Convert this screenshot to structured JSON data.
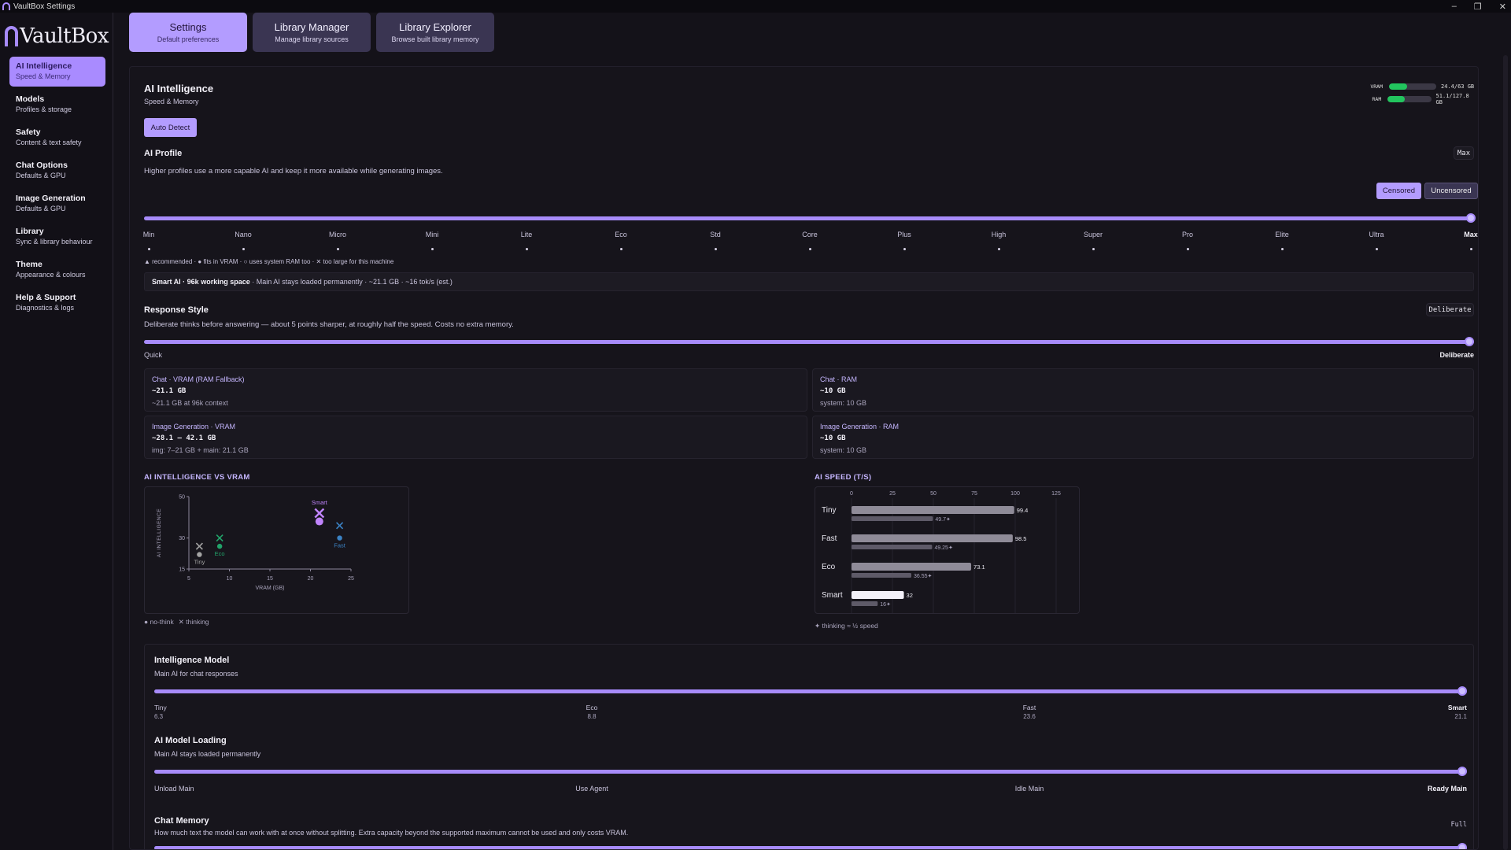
{
  "window": {
    "title": "VaultBox Settings",
    "controls": [
      "–",
      "❐",
      "✕"
    ]
  },
  "brand": {
    "name": "VaultBox"
  },
  "sidebar": {
    "items": [
      {
        "label": "AI Intelligence",
        "sub": "Speed & Memory",
        "active": true
      },
      {
        "label": "Models",
        "sub": "Profiles & storage"
      },
      {
        "label": "Safety",
        "sub": "Content & text safety"
      },
      {
        "label": "Chat Options",
        "sub": "Defaults & GPU"
      },
      {
        "label": "Image Generation",
        "sub": "Defaults & GPU"
      },
      {
        "label": "Library",
        "sub": "Sync & library behaviour"
      },
      {
        "label": "Theme",
        "sub": "Appearance & colours"
      },
      {
        "label": "Help & Support",
        "sub": "Diagnostics & logs"
      }
    ]
  },
  "tabs": [
    {
      "label": "Settings",
      "sub": "Default preferences",
      "active": true
    },
    {
      "label": "Library Manager",
      "sub": "Manage library sources"
    },
    {
      "label": "Library Explorer",
      "sub": "Browse built library memory"
    }
  ],
  "header": {
    "title": "AI Intelligence",
    "subtitle": "Speed & Memory",
    "auto_detect": "Auto Detect"
  },
  "meters": {
    "vram": {
      "label": "VRAM",
      "text": "24.4/63 GB",
      "fraction": 0.39
    },
    "ram": {
      "label": "RAM",
      "text": "51.1/127.8 GB",
      "fraction": 0.4
    },
    "bar_color": "#22c55e"
  },
  "profile": {
    "title": "AI Profile",
    "value": "Max",
    "desc": "Higher profiles use a more capable AI and keep it more available while generating images.",
    "censor": {
      "options": [
        "Censored",
        "Uncensored"
      ],
      "selected": "Censored"
    },
    "ticks": [
      "Min",
      "Nano",
      "Micro",
      "Mini",
      "Lite",
      "Eco",
      "Std",
      "Core",
      "Plus",
      "High",
      "Super",
      "Pro",
      "Elite",
      "Ultra",
      "Max"
    ],
    "selected_index": 14,
    "legend": "▲ recommended · ● fits in VRAM · ○ uses system RAM too · ✕ too large for this machine",
    "summary_bold": "Smart AI · 96k working space",
    "summary_rest": " · Main AI stays loaded permanently · ~21.1 GB · ~16 tok/s (est.)"
  },
  "response": {
    "title": "Response Style",
    "value": "Deliberate",
    "desc": "Deliberate thinks before answering — about 5 points sharper, at roughly half the speed. Costs no extra memory.",
    "min_label": "Quick",
    "max_label": "Deliberate",
    "level": 1.0
  },
  "cards": [
    {
      "title": "Chat · VRAM (RAM Fallback)",
      "value": "~21.1 GB",
      "sub": "~21.1 GB at 96k context"
    },
    {
      "title": "Chat · RAM",
      "value": "~10 GB",
      "sub": "system: 10 GB"
    },
    {
      "title": "Image Generation · VRAM",
      "value": "~28.1 – 42.1 GB",
      "sub": "img: 7–21 GB + main: 21.1 GB"
    },
    {
      "title": "Image Generation · RAM",
      "value": "~10 GB",
      "sub": "system: 10 GB"
    }
  ],
  "chart_data": [
    {
      "type": "scatter",
      "title": "AI INTELLIGENCE VS VRAM",
      "xlabel": "VRAM (GB)",
      "ylabel": "AI INTELLIGENCE",
      "xlim": [
        5,
        25
      ],
      "ylim": [
        15,
        50
      ],
      "xticks": [
        5,
        10,
        15,
        20,
        25
      ],
      "yticks": [
        15,
        30,
        50
      ],
      "points": [
        {
          "label": "Tiny",
          "x": 6.3,
          "no_think": 22,
          "thinking": 26,
          "color": "#a3a3a3"
        },
        {
          "label": "Eco",
          "x": 8.8,
          "no_think": 26,
          "thinking": 30,
          "color": "#22a36a"
        },
        {
          "label": "Smart",
          "x": 21.1,
          "no_think": 38,
          "thinking": 42,
          "color": "#c084fc"
        },
        {
          "label": "Fast",
          "x": 23.6,
          "no_think": 30,
          "thinking": 36,
          "color": "#3b82c4"
        }
      ],
      "legend": [
        "● no-think",
        "✕ thinking"
      ]
    },
    {
      "type": "bar",
      "title": "AI SPEED (T/S)",
      "xlim": [
        0,
        125
      ],
      "xticks": [
        0,
        25,
        50,
        75,
        100,
        125
      ],
      "categories": [
        "Tiny",
        "Fast",
        "Eco",
        "Smart"
      ],
      "series": [
        {
          "values": [
            99.4,
            98.5,
            73.1,
            32
          ],
          "labels": [
            "99.4",
            "98.5",
            "73.1",
            "32"
          ]
        },
        {
          "values": [
            49.7,
            49.25,
            36.55,
            16
          ],
          "labels": [
            "49.7✦",
            "49.25✦",
            "36.55✦",
            "16✦"
          ]
        }
      ],
      "footnote": "✦ thinking ≈ ½ speed"
    }
  ],
  "intel_model": {
    "title": "Intelligence Model",
    "desc": "Main AI for chat responses",
    "ticks": [
      {
        "label": "Tiny",
        "val": "6.3"
      },
      {
        "label": "Eco",
        "val": "8.8"
      },
      {
        "label": "Fast",
        "val": "23.6"
      },
      {
        "label": "Smart",
        "val": "21.1"
      }
    ],
    "selected_index": 3
  },
  "loading": {
    "title": "AI Model Loading",
    "desc": "Main AI stays loaded permanently",
    "ticks": [
      "Unload Main",
      "Use Agent",
      "Idle Main",
      "Ready Main"
    ],
    "selected_index": 3
  },
  "memory": {
    "title": "Chat Memory",
    "desc": "How much text the model can work with at once without splitting. Extra capacity beyond the supported maximum cannot be used and only costs VRAM.",
    "value": "Full"
  }
}
